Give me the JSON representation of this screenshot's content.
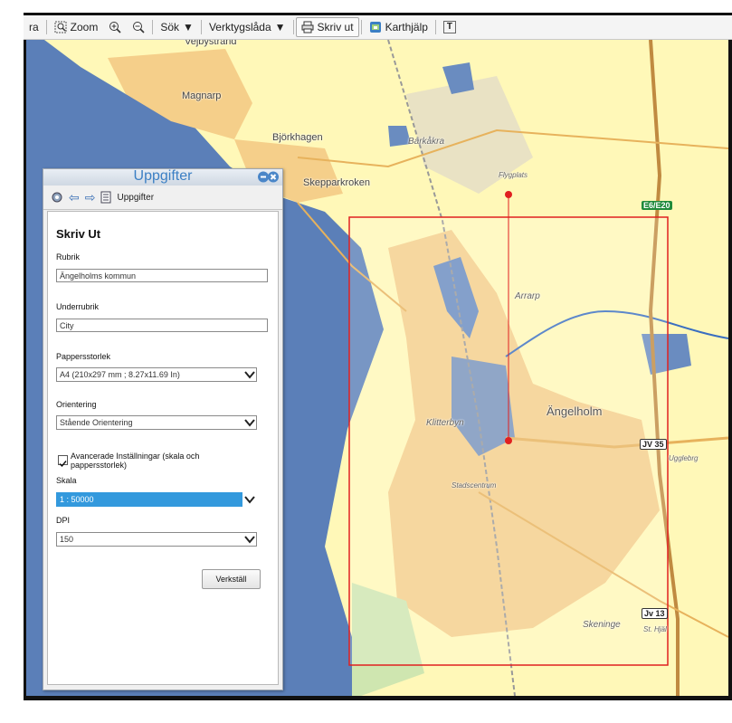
{
  "toolbar": {
    "cut_off_label": "ra",
    "zoom_label": "Zoom",
    "search_label": "Sök",
    "toolbox_label": "Verktygslåda",
    "print_label": "Skriv ut",
    "help_label": "Karthjälp",
    "text_tool_label": "T"
  },
  "map": {
    "places": {
      "vejbystrand": "Vejbystrand",
      "magnarp": "Magnarp",
      "bjorkhagen": "Björkhagen",
      "skepparkroken": "Skepparkroken",
      "barkakra": "Barkåkra",
      "flygplats": "Flygplats",
      "arrarp": "Arrarp",
      "angelholm": "Ängelholm",
      "klitterbyn": "Klitterbyn",
      "stadcentrum": "Stadscentrum",
      "skeninge": "Skeninge",
      "ugglebrg": "Ugglebrg",
      "st_hjal": "St. Hjäl"
    },
    "shields": {
      "e6": "E6/E20",
      "r13": "Jv 13",
      "r35": "JV 35"
    },
    "colors": {
      "land": "#fff8b8",
      "water": "#5b7fb8",
      "urban": "#f5cf8a",
      "print_frame": "#e02020"
    }
  },
  "panel": {
    "title": "Uppgifter",
    "nav_label": "Uppgifter",
    "heading": "Skriv Ut",
    "rubrik_label": "Rubrik",
    "rubrik_value": "Ängelholms kommun",
    "underrubrik_label": "Underrubrik",
    "underrubrik_value": "City",
    "papper_label": "Pappersstorlek",
    "papper_value": "A4 (210x297 mm ; 8.27x11.69 In)",
    "orientering_label": "Orientering",
    "orientering_value": "Stående Orientering",
    "advanced_label": "Avancerade Inställningar (skala och pappersstorlek)",
    "advanced_checked": true,
    "skala_label": "Skala",
    "skala_value": "1 : 50000",
    "dpi_label": "DPI",
    "dpi_value": "150",
    "apply_label": "Verkställ"
  }
}
